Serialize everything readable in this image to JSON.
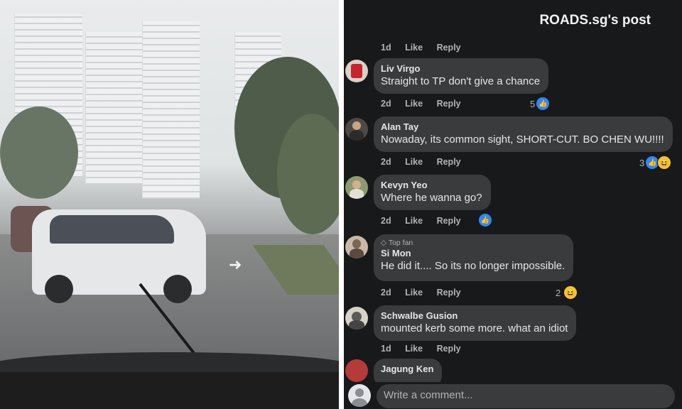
{
  "post": {
    "title": "ROADS.sg's post"
  },
  "actions": {
    "like": "Like",
    "reply": "Reply"
  },
  "top_meta": {
    "time": "1d"
  },
  "comments": [
    {
      "author": "Liv Virgo",
      "text": "Straight to TP don't give a chance",
      "time": "2d",
      "reaction_count": "5",
      "reactions": [
        "like"
      ]
    },
    {
      "author": "Alan Tay",
      "text": "Nowaday, its common sight, SHORT-CUT. BO CHEN WU!!!!",
      "time": "2d",
      "reaction_count": "3",
      "reactions": [
        "like",
        "haha"
      ]
    },
    {
      "author": "Kevyn Yeo",
      "text": "Where he wanna go?",
      "time": "2d",
      "reaction_count": "",
      "reactions": [
        "like"
      ]
    },
    {
      "author": "Si Mon",
      "badge": "Top fan",
      "text": "He did it.... So its no longer impossible.",
      "time": "2d",
      "reaction_count": "2",
      "reactions": [
        "haha"
      ]
    },
    {
      "author": "Schwalbe Gusion",
      "text": "mounted kerb some more. what an idiot",
      "time": "1d",
      "reaction_count": "",
      "reactions": []
    },
    {
      "author": "Jagung Ken",
      "text": "",
      "time": "",
      "reaction_count": "",
      "reactions": []
    }
  ],
  "composer": {
    "placeholder": "Write a comment..."
  },
  "icons": {
    "like": "thumbs-up-icon",
    "haha": "laughing-emoji-icon",
    "top_fan": "diamond-badge-icon"
  },
  "colors": {
    "background": "#18191a",
    "bubble": "#3a3b3c",
    "like_blue": "#2d88ff",
    "text": "#e4e6eb",
    "muted": "#b0b3b8"
  }
}
